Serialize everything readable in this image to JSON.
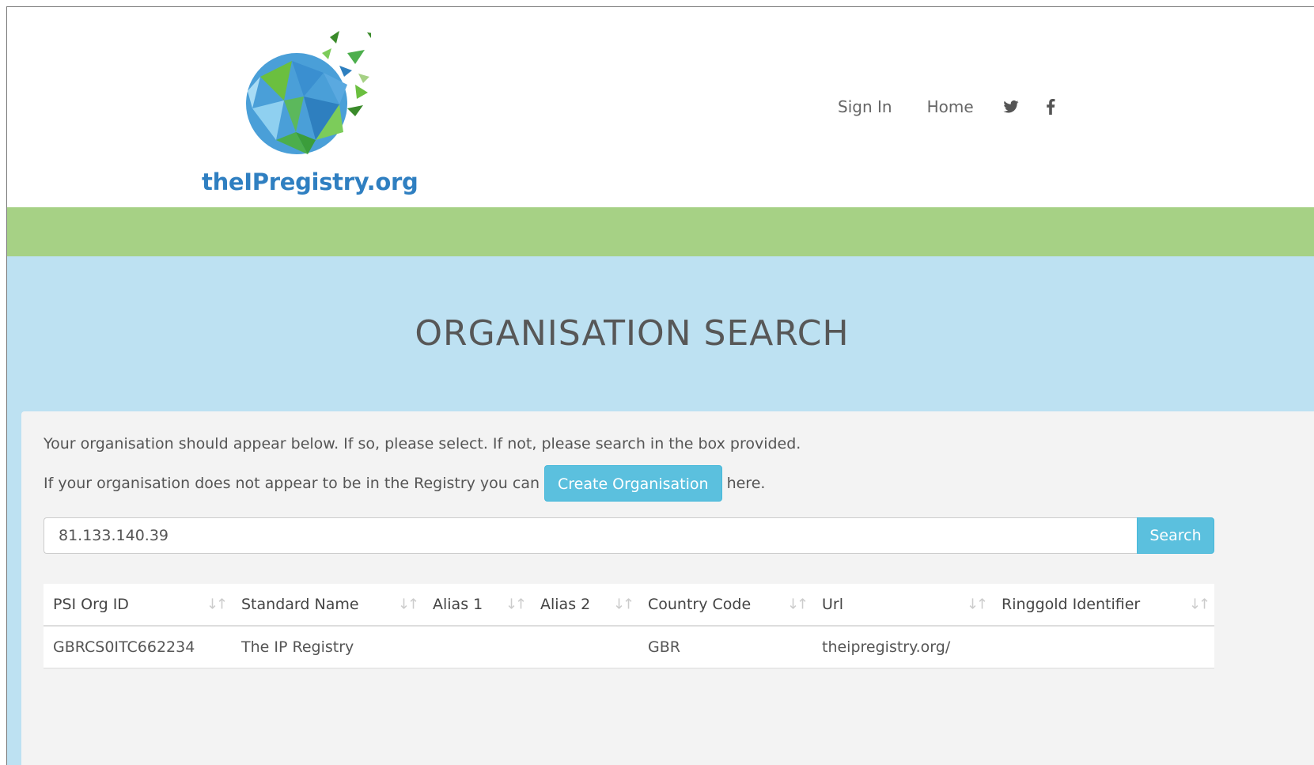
{
  "header": {
    "logo_text": "theIPregistry.org",
    "nav": {
      "sign_in": "Sign In",
      "home": "Home",
      "icons": [
        "twitter-icon",
        "facebook-icon"
      ]
    }
  },
  "hero": {
    "title": "ORGANISATION SEARCH"
  },
  "panel": {
    "intro": "Your organisation should appear below. If so, please select. If not, please search in the box provided.",
    "create_prefix": "If your organisation does not appear to be in the Registry you can",
    "create_button": "Create Organisation",
    "create_suffix": "here.",
    "search": {
      "value": "81.133.140.39",
      "button": "Search"
    }
  },
  "table": {
    "columns": [
      "PSI Org ID",
      "Standard Name",
      "Alias 1",
      "Alias 2",
      "Country Code",
      "Url",
      "Ringgold Identifier"
    ],
    "rows": [
      [
        "GBRCS0ITC662234",
        "The IP Registry",
        "",
        "",
        "GBR",
        "theipregistry.org/",
        ""
      ]
    ]
  },
  "colors": {
    "green_bar": "#a6d185",
    "hero_bg": "#bde1f2",
    "button_blue": "#5bc0de",
    "logo_blue": "#2f7fc1"
  }
}
